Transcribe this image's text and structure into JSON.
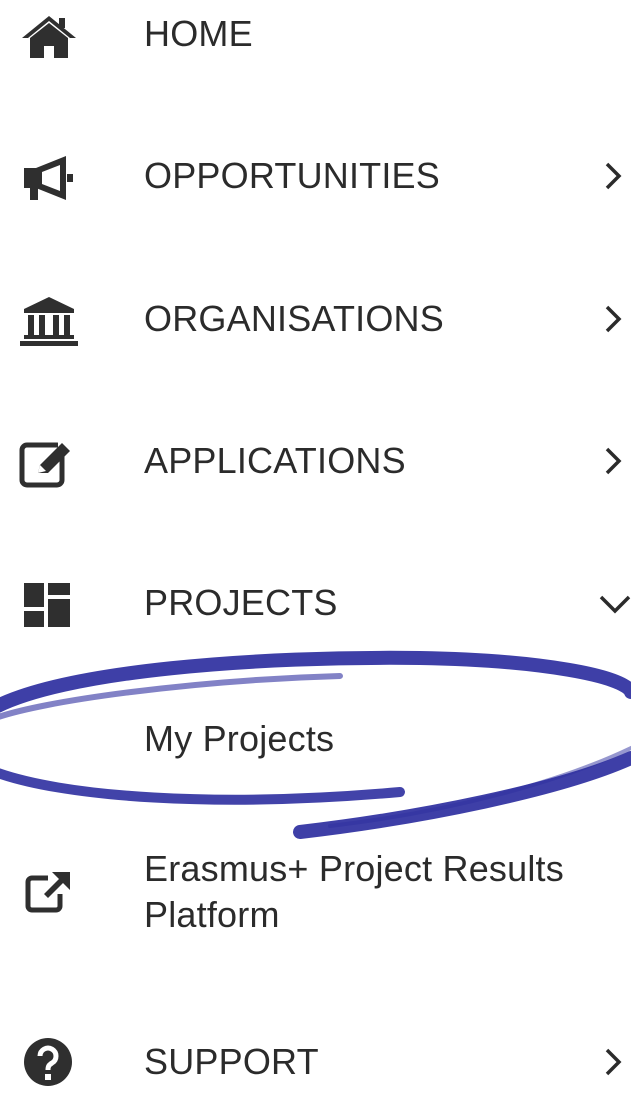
{
  "menu": {
    "home": {
      "label": "HOME",
      "icon": "home-icon"
    },
    "opportunities": {
      "label": "OPPORTUNITIES",
      "icon": "megaphone-icon"
    },
    "organisations": {
      "label": "ORGANISATIONS",
      "icon": "institution-icon"
    },
    "applications": {
      "label": "APPLICATIONS",
      "icon": "edit-icon"
    },
    "projects": {
      "label": "PROJECTS",
      "icon": "dashboard-icon",
      "expanded": true
    },
    "my_projects": {
      "label": "My Projects"
    },
    "results_platform": {
      "line1": "Erasmus+ Project Results",
      "line2": "Platform",
      "icon": "external-link-icon"
    },
    "support": {
      "label": "SUPPORT",
      "icon": "question-icon"
    }
  },
  "colors": {
    "text": "#2b2b2b",
    "icon": "#2f2f2f",
    "annotation": "#2e2fa0"
  }
}
